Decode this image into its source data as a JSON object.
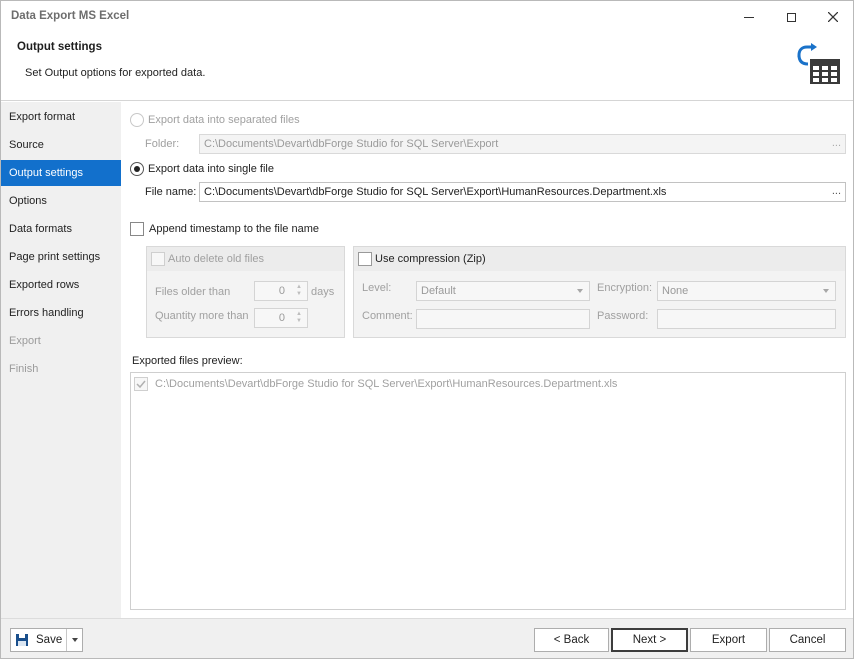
{
  "window": {
    "title": "Data Export MS Excel",
    "controls": {
      "minimize": "minimize-icon",
      "maximize": "maximize-icon",
      "close": "close-icon"
    }
  },
  "header": {
    "title": "Output settings",
    "subtitle": "Set Output options for exported data.",
    "icon": "export-table-icon",
    "icon_color": "#1a72c9"
  },
  "sidebar": {
    "items": [
      {
        "label": "Export format",
        "state": "normal"
      },
      {
        "label": "Source",
        "state": "normal"
      },
      {
        "label": "Output settings",
        "state": "active"
      },
      {
        "label": "Options",
        "state": "normal"
      },
      {
        "label": "Data formats",
        "state": "normal"
      },
      {
        "label": "Page print settings",
        "state": "normal"
      },
      {
        "label": "Exported rows",
        "state": "normal"
      },
      {
        "label": "Errors handling",
        "state": "normal"
      },
      {
        "label": "Export",
        "state": "disabled"
      },
      {
        "label": "Finish",
        "state": "disabled"
      }
    ],
    "accent": "#1270cc"
  },
  "output": {
    "separated": {
      "label": "Export data into separated files",
      "selected": false,
      "folder_label": "Folder:",
      "folder_value": "C:\\Documents\\Devart\\dbForge Studio for SQL Server\\Export",
      "browse": "..."
    },
    "single": {
      "label": "Export data into single file",
      "selected": true,
      "file_label": "File name:",
      "file_value": "C:\\Documents\\Devart\\dbForge Studio for SQL Server\\Export\\HumanResources.Department.xls",
      "browse": "..."
    },
    "append_timestamp": {
      "label": "Append timestamp to the file name",
      "checked": false
    },
    "auto_delete": {
      "label": "Auto delete old files",
      "checked": false,
      "files_older_label": "Files older than",
      "files_older_value": "0",
      "days_label": "days",
      "quantity_label": "Quantity more than",
      "quantity_value": "0"
    },
    "compression": {
      "label": "Use compression (Zip)",
      "checked": false,
      "level_label": "Level:",
      "level_value": "Default",
      "encryption_label": "Encryption:",
      "encryption_value": "None",
      "comment_label": "Comment:",
      "comment_value": "",
      "password_label": "Password:",
      "password_value": ""
    },
    "preview": {
      "label": "Exported files preview:",
      "items": [
        {
          "checked": true,
          "path": "C:\\Documents\\Devart\\dbForge Studio for SQL Server\\Export\\HumanResources.Department.xls"
        }
      ]
    }
  },
  "footer": {
    "save": "Save",
    "back": "< Back",
    "next": "Next >",
    "export": "Export",
    "cancel": "Cancel"
  }
}
